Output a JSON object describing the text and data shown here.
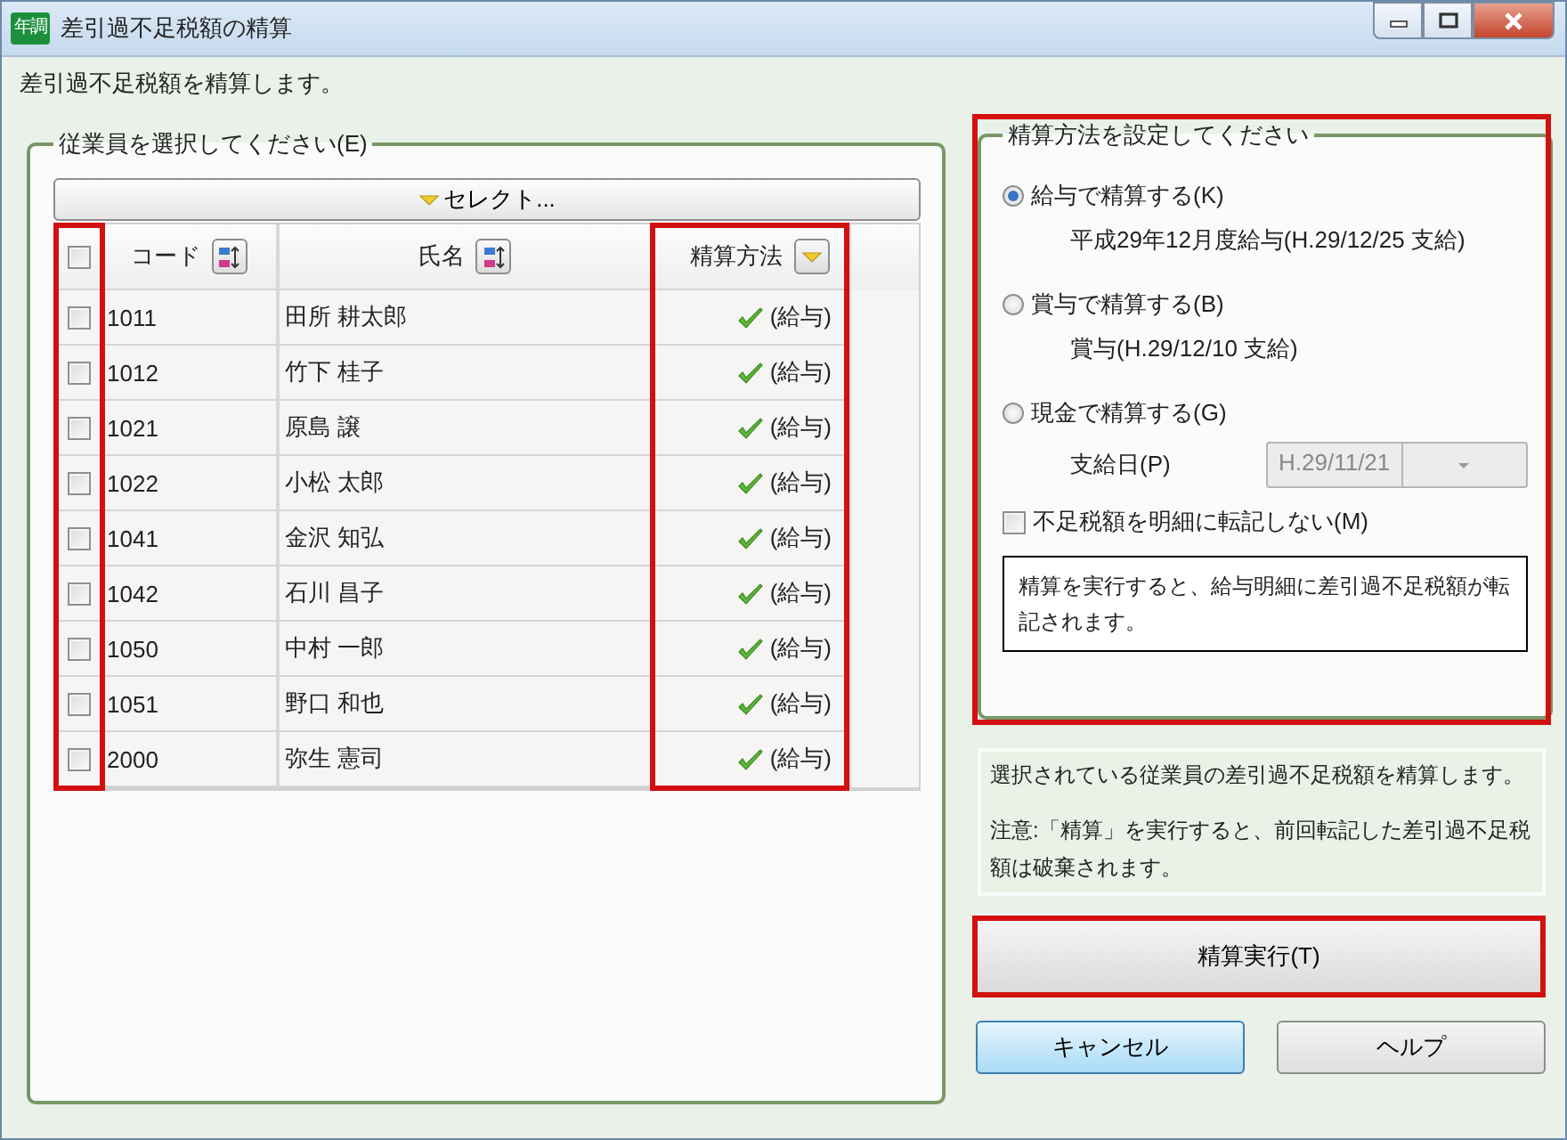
{
  "window": {
    "title": "差引過不足税額の精算",
    "app_icon_text": "年調"
  },
  "description": "差引過不足税額を精算します。",
  "employee_group": {
    "legend": "従業員を選択してください(E)",
    "select_button": "セレクト...",
    "table": {
      "columns": [
        {
          "kind": "check",
          "checked": false,
          "highlighted": true
        },
        {
          "kind": "sort",
          "label": "コード",
          "highlighted": false
        },
        {
          "kind": "sort",
          "label": "氏名",
          "highlighted": false
        },
        {
          "kind": "filter",
          "label": "精算方法",
          "highlighted": true
        }
      ],
      "rows": [
        {
          "checked": false,
          "code": "1011",
          "name": "田所 耕太郎",
          "method": "(給与)"
        },
        {
          "checked": false,
          "code": "1012",
          "name": "竹下 桂子",
          "method": "(給与)"
        },
        {
          "checked": false,
          "code": "1021",
          "name": "原島 譲",
          "method": "(給与)"
        },
        {
          "checked": false,
          "code": "1022",
          "name": "小松 太郎",
          "method": "(給与)"
        },
        {
          "checked": false,
          "code": "1041",
          "name": "金沢 知弘",
          "method": "(給与)"
        },
        {
          "checked": false,
          "code": "1042",
          "name": "石川 昌子",
          "method": "(給与)"
        },
        {
          "checked": false,
          "code": "1050",
          "name": "中村 一郎",
          "method": "(給与)"
        },
        {
          "checked": false,
          "code": "1051",
          "name": "野口 和也",
          "method": "(給与)"
        },
        {
          "checked": false,
          "code": "2000",
          "name": "弥生 憲司",
          "method": "(給与)"
        }
      ]
    }
  },
  "method_group": {
    "legend": "精算方法を設定してください",
    "highlighted": true,
    "options": [
      {
        "label": "給与で精算する(K)",
        "selected": true,
        "detail": "平成29年12月度給与(H.29/12/25 支給)"
      },
      {
        "label": "賞与で精算する(B)",
        "selected": false,
        "detail": "賞与(H.29/12/10 支給)"
      },
      {
        "label": "現金で精算する(G)",
        "selected": false,
        "date_label": "支給日(P)",
        "date_value": "H.29/11/21",
        "date_disabled": true
      }
    ],
    "no_transfer": {
      "label": "不足税額を明細に転記しない(M)",
      "checked": false
    },
    "note": "精算を実行すると、給与明細に差引過不足税額が転記されます。"
  },
  "info": [
    "選択されている従業員の差引過不足税額を精算します。",
    "注意:「精算」を実行すると、前回転記した差引過不足税額は破棄されます。"
  ],
  "execute_button": {
    "label": "精算実行(T)",
    "highlighted": true
  },
  "buttons": [
    {
      "label": "キャンセル",
      "default": true
    },
    {
      "label": "ヘルプ",
      "default": false
    }
  ]
}
